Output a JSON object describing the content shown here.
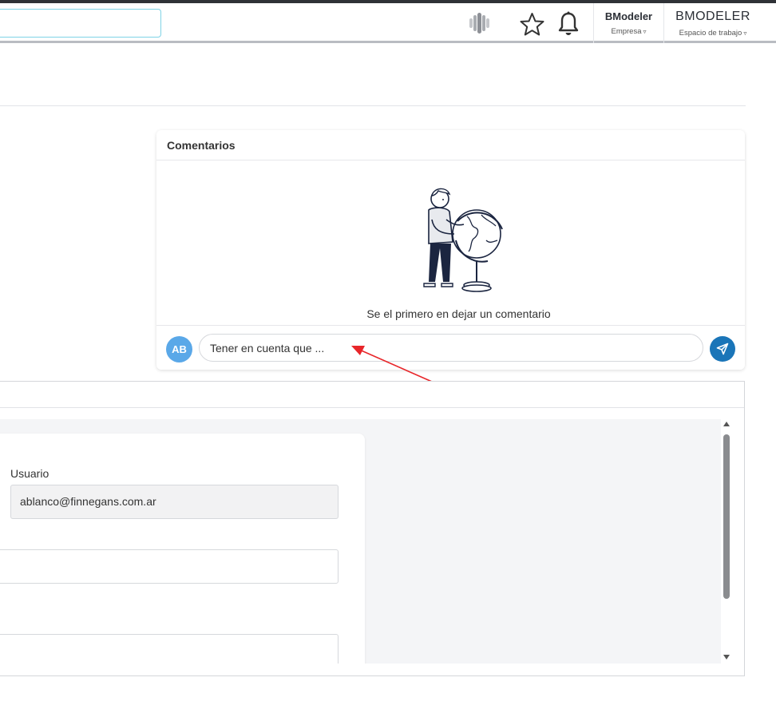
{
  "header": {
    "company": {
      "name": "BModeler",
      "label": "Empresa"
    },
    "workspace": {
      "name": "BMODELER",
      "label": "Espacio de trabajo"
    },
    "icons": [
      "brain-icon",
      "star-icon",
      "bell-icon",
      "chevron-down-icon"
    ]
  },
  "comments": {
    "title": "Comentarios",
    "empty_text": "Se el primero en dejar un comentario",
    "avatar_initials": "AB",
    "input_value": "Tener en cuenta que ...",
    "avatar_color": "#5aa8e8",
    "send_color": "#1a75b8"
  },
  "form": {
    "user_label": "Usuario",
    "user_value": "ablanco@finnegans.com.ar"
  },
  "colors": {
    "annotation_arrow": "#e8262a",
    "search_border": "#7fd3e6"
  }
}
